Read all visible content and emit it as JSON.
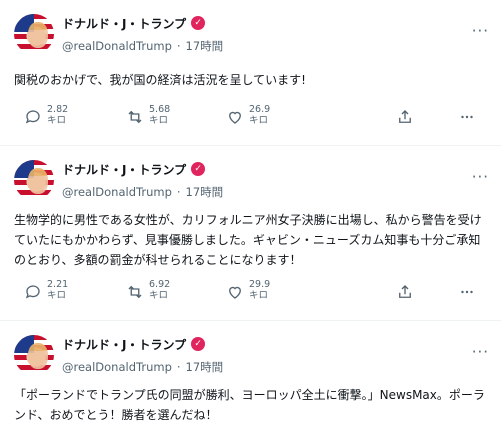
{
  "posts": [
    {
      "name": "ドナルド・J・トランプ",
      "handle": "@realDonaldTrump",
      "time": "17時間",
      "text": "関税のおかげで、我が国の経済は活況を呈しています!",
      "replies": "2.82",
      "reposts": "5.68",
      "likes": "26.9",
      "unit": "キロ"
    },
    {
      "name": "ドナルド・J・トランプ",
      "handle": "@realDonaldTrump",
      "time": "17時間",
      "text": "生物学的に男性である女性が、カリフォルニア州女子決勝に出場し、私から警告を受けていたにもかかわらず、見事優勝しました。ギャビン・ニューズカム知事も十分ご承知のとおり、多額の罰金が科せられることになります！",
      "replies": "2.21",
      "reposts": "6.92",
      "likes": "29.9",
      "unit": "キロ"
    },
    {
      "name": "ドナルド・J・トランプ",
      "handle": "@realDonaldTrump",
      "time": "17時間",
      "text": "「ポーランドでトランプ氏の同盟が勝利、ヨーロッパ全土に衝撃。」NewsMax。ポーランド、おめでとう！勝者を選んだね！"
    }
  ],
  "dot": "·",
  "verified_glyph": "✓",
  "more_glyph": "···",
  "colors": {
    "verified": "#e0245e",
    "muted": "#536471",
    "text": "#0f1419"
  }
}
